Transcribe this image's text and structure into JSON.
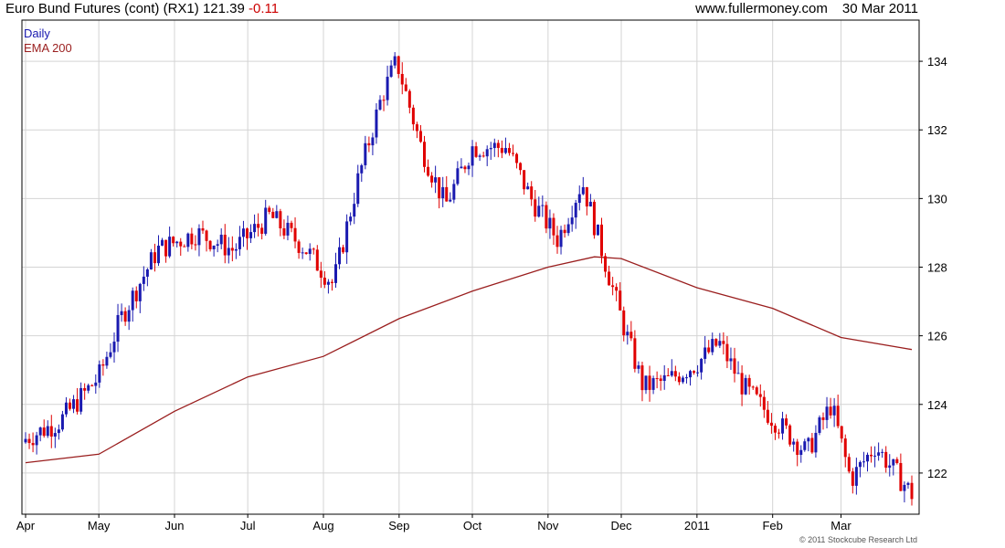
{
  "header": {
    "title": "Euro Bund Futures (cont) (RX1)",
    "last": "121.39",
    "change": "-0.11",
    "site": "www.fullermoney.com",
    "date": "30 Mar 2011"
  },
  "legend": {
    "daily": "Daily",
    "ema": "EMA 200"
  },
  "copyright": "© 2011 Stockcube Research Ltd",
  "colors": {
    "up": "#1a1ab0",
    "down": "#e00000",
    "ema": "#9a1e1e",
    "grid": "#d4d4d4",
    "frame": "#000000"
  },
  "chart_data": {
    "type": "line",
    "subtype": "candlestick-with-moving-average",
    "title": "Euro Bund Futures (cont) (RX1)",
    "ylim": [
      120.8,
      135.2
    ],
    "y_ticks": [
      122,
      124,
      126,
      128,
      130,
      132,
      134
    ],
    "y_tick_labels": [
      "122",
      "124",
      "126",
      "128",
      "130",
      "132",
      "134"
    ],
    "x_start": "2010-04-01",
    "x_end": "2011-03-30",
    "x_tick_labels": [
      {
        "label": "Apr",
        "date": "2010-04-01"
      },
      {
        "label": "May",
        "date": "2010-05-01"
      },
      {
        "label": "Jun",
        "date": "2010-06-01"
      },
      {
        "label": "Jul",
        "date": "2010-07-01"
      },
      {
        "label": "Aug",
        "date": "2010-08-01"
      },
      {
        "label": "Sep",
        "date": "2010-09-01"
      },
      {
        "label": "Oct",
        "date": "2010-10-01"
      },
      {
        "label": "Nov",
        "date": "2010-11-01"
      },
      {
        "label": "Dec",
        "date": "2010-12-01"
      },
      {
        "label": "2011",
        "date": "2011-01-01"
      },
      {
        "label": "Feb",
        "date": "2011-02-01"
      },
      {
        "label": "Mar",
        "date": "2011-03-01"
      }
    ],
    "grid": true,
    "legend_position": "top-left",
    "series": [
      {
        "name": "Daily",
        "kind": "close",
        "x": [
          "2010-04-01",
          "2010-04-15",
          "2010-05-01",
          "2010-05-10",
          "2010-05-25",
          "2010-06-10",
          "2010-06-25",
          "2010-07-10",
          "2010-07-25",
          "2010-08-05",
          "2010-08-15",
          "2010-08-25",
          "2010-08-31",
          "2010-09-10",
          "2010-09-20",
          "2010-10-01",
          "2010-10-15",
          "2010-10-25",
          "2010-11-05",
          "2010-11-15",
          "2010-11-25",
          "2010-12-01",
          "2010-12-10",
          "2010-12-20",
          "2011-01-01",
          "2011-01-10",
          "2011-01-20",
          "2011-02-01",
          "2011-02-15",
          "2011-02-25",
          "2011-03-05",
          "2011-03-15",
          "2011-03-30"
        ],
        "y": [
          123.0,
          123.5,
          124.8,
          126.5,
          128.5,
          129.0,
          128.5,
          129.5,
          128.5,
          127.5,
          130.5,
          133.0,
          134.0,
          131.5,
          129.8,
          131.5,
          131.5,
          130.0,
          128.8,
          130.5,
          128.0,
          126.5,
          124.5,
          124.7,
          125.2,
          125.8,
          124.5,
          123.6,
          122.6,
          124.0,
          121.8,
          122.8,
          121.39
        ]
      },
      {
        "name": "EMA 200",
        "kind": "ema",
        "x": [
          "2010-04-01",
          "2010-05-01",
          "2010-06-01",
          "2010-07-01",
          "2010-08-01",
          "2010-09-01",
          "2010-10-01",
          "2010-11-01",
          "2010-11-20",
          "2010-12-01",
          "2011-01-01",
          "2011-02-01",
          "2011-03-01",
          "2011-03-30"
        ],
        "y": [
          122.3,
          122.55,
          123.8,
          124.8,
          125.4,
          126.5,
          127.3,
          128.0,
          128.3,
          128.25,
          127.4,
          126.8,
          125.95,
          125.6
        ]
      }
    ]
  }
}
